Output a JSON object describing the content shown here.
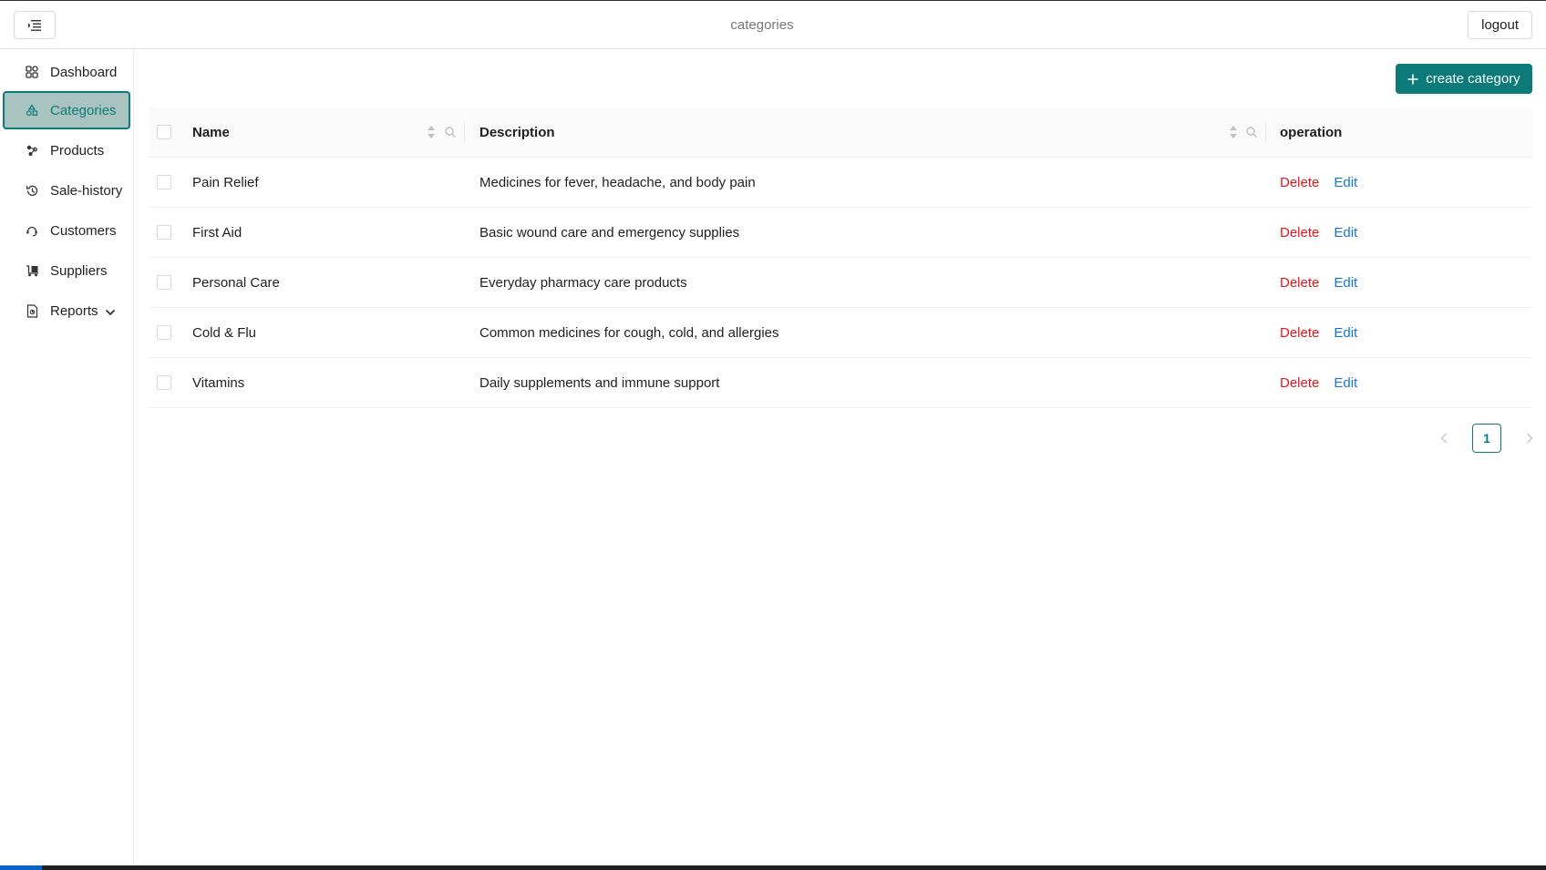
{
  "header": {
    "title": "categories",
    "logout_label": "logout"
  },
  "sidebar": {
    "items": [
      {
        "label": "Dashboard",
        "icon": "dashboard-icon"
      },
      {
        "label": "Categories",
        "icon": "categories-icon"
      },
      {
        "label": "Products",
        "icon": "products-icon"
      },
      {
        "label": "Sale-history",
        "icon": "history-icon"
      },
      {
        "label": "Customers",
        "icon": "customers-icon"
      },
      {
        "label": "Suppliers",
        "icon": "suppliers-icon"
      },
      {
        "label": "Reports",
        "icon": "reports-icon"
      }
    ],
    "active_index": 1
  },
  "toolbar": {
    "create_label": "create category"
  },
  "table": {
    "columns": [
      "Name",
      "Description",
      "operation"
    ],
    "rows": [
      {
        "name": "Pain Relief",
        "description": "Medicines for fever, headache, and body pain"
      },
      {
        "name": "First Aid",
        "description": "Basic wound care and emergency supplies"
      },
      {
        "name": "Personal Care",
        "description": "Everyday pharmacy care products"
      },
      {
        "name": "Cold & Flu",
        "description": "Common medicines for cough, cold, and allergies"
      },
      {
        "name": "Vitamins",
        "description": "Daily supplements and immune support"
      }
    ],
    "delete_label": "Delete",
    "edit_label": "Edit"
  },
  "pagination": {
    "current_page": "1"
  },
  "colors": {
    "accent": "#0b7a78",
    "active_nav_bg": "#a9c3c1",
    "delete": "#e5151e",
    "edit": "#1677d6"
  }
}
